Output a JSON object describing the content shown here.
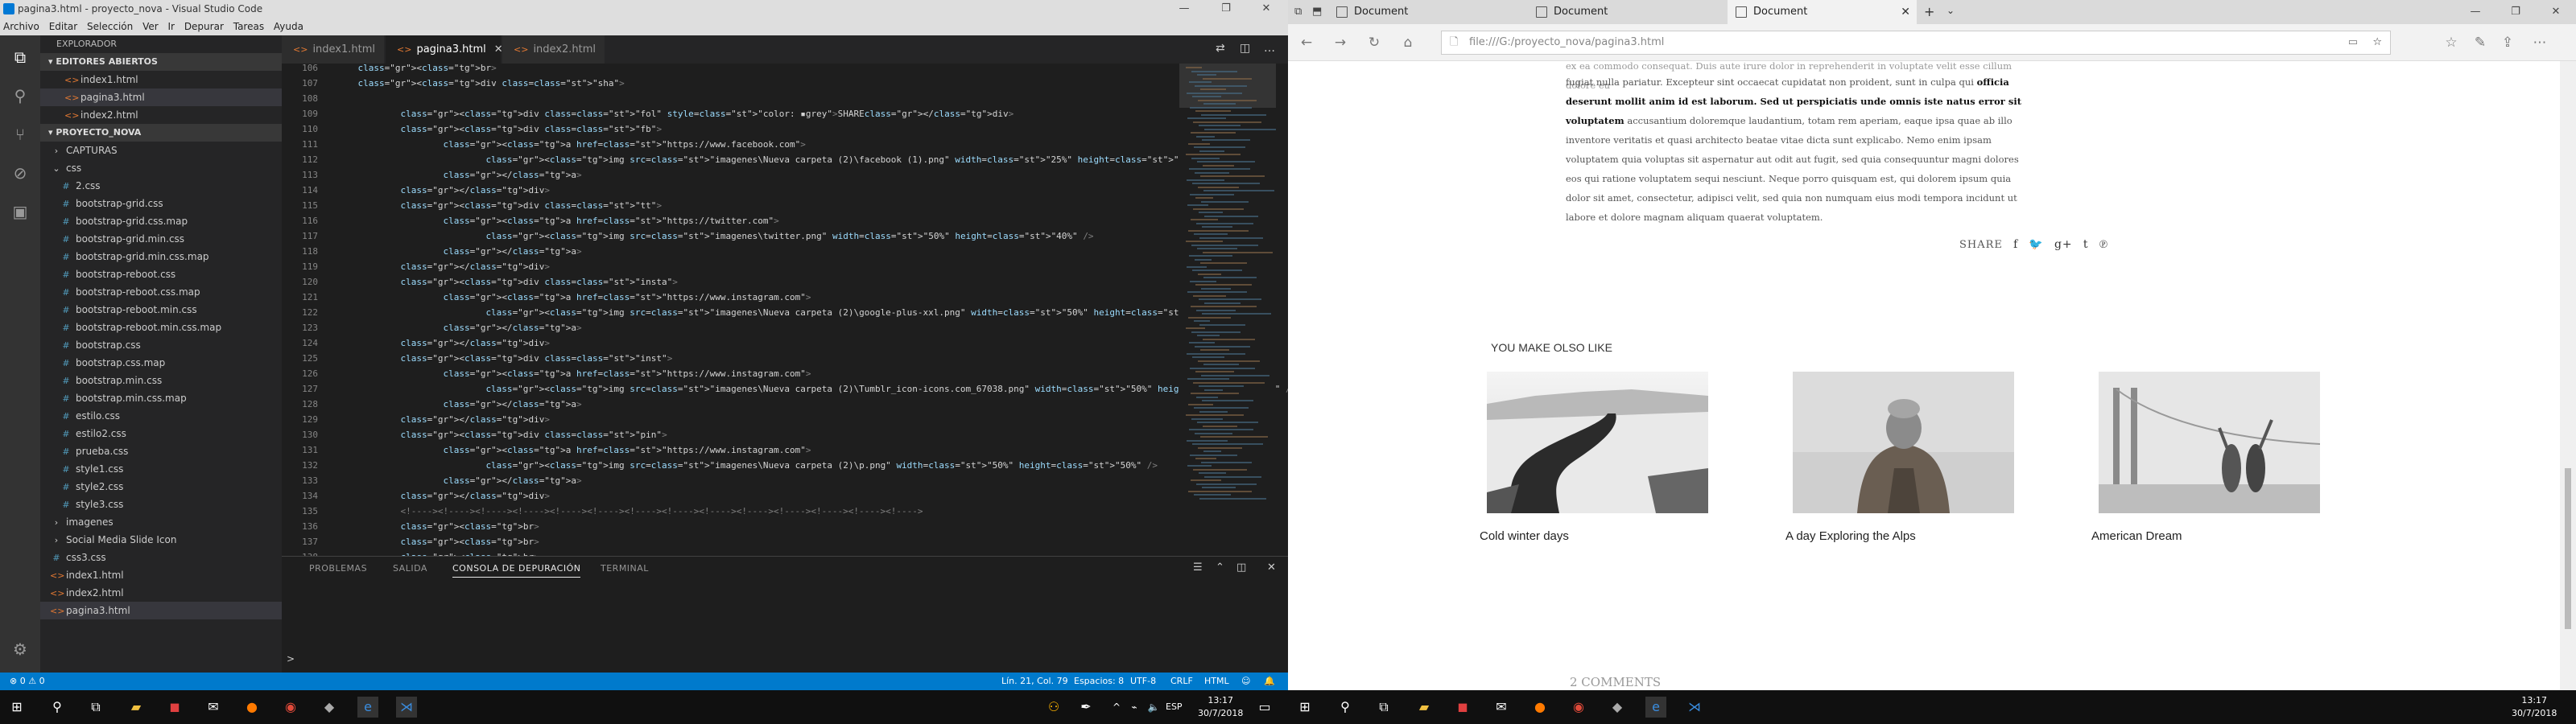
{
  "vscode": {
    "title": "pagina3.html - proyecto_nova - Visual Studio Code",
    "menu": [
      "Archivo",
      "Editar",
      "Selección",
      "Ver",
      "Ir",
      "Depurar",
      "Tareas",
      "Ayuda"
    ],
    "explorer_title": "EXPLORADOR",
    "open_editors_title": "EDITORES ABIERTOS",
    "open_editors": [
      "index1.html",
      "pagina3.html",
      "index2.html"
    ],
    "project_title": "PROYECTO_NOVA",
    "tree": [
      {
        "label": "CAPTURAS",
        "type": "folder",
        "depth": 1
      },
      {
        "label": "css",
        "type": "folder-open",
        "depth": 1
      },
      {
        "label": "2.css",
        "type": "css",
        "depth": 2
      },
      {
        "label": "bootstrap-grid.css",
        "type": "css",
        "depth": 2
      },
      {
        "label": "bootstrap-grid.css.map",
        "type": "css",
        "depth": 2
      },
      {
        "label": "bootstrap-grid.min.css",
        "type": "css",
        "depth": 2
      },
      {
        "label": "bootstrap-grid.min.css.map",
        "type": "css",
        "depth": 2
      },
      {
        "label": "bootstrap-reboot.css",
        "type": "css",
        "depth": 2
      },
      {
        "label": "bootstrap-reboot.css.map",
        "type": "css",
        "depth": 2
      },
      {
        "label": "bootstrap-reboot.min.css",
        "type": "css",
        "depth": 2
      },
      {
        "label": "bootstrap-reboot.min.css.map",
        "type": "css",
        "depth": 2
      },
      {
        "label": "bootstrap.css",
        "type": "css",
        "depth": 2
      },
      {
        "label": "bootstrap.css.map",
        "type": "css",
        "depth": 2
      },
      {
        "label": "bootstrap.min.css",
        "type": "css",
        "depth": 2
      },
      {
        "label": "bootstrap.min.css.map",
        "type": "css",
        "depth": 2
      },
      {
        "label": "estilo.css",
        "type": "css",
        "depth": 2
      },
      {
        "label": "estilo2.css",
        "type": "css",
        "depth": 2
      },
      {
        "label": "prueba.css",
        "type": "css",
        "depth": 2
      },
      {
        "label": "style1.css",
        "type": "css",
        "depth": 2
      },
      {
        "label": "style2.css",
        "type": "css",
        "depth": 2
      },
      {
        "label": "style3.css",
        "type": "css",
        "depth": 2
      },
      {
        "label": "imagenes",
        "type": "folder",
        "depth": 1
      },
      {
        "label": "Social Media Slide Icon",
        "type": "folder",
        "depth": 1
      },
      {
        "label": "css3.css",
        "type": "css",
        "depth": 1
      },
      {
        "label": "index1.html",
        "type": "html",
        "depth": 1
      },
      {
        "label": "index2.html",
        "type": "html",
        "depth": 1
      },
      {
        "label": "pagina3.html",
        "type": "html",
        "depth": 1
      }
    ],
    "tabs": [
      "index1.html",
      "pagina3.html",
      "index2.html"
    ],
    "active_tab": "pagina3.html",
    "line_start": 106,
    "code_lines": [
      "    <br>",
      "    <div class=\"sha\">",
      "",
      "            <div class=\"fol\" style=\"color: ▪grey\">SHARE</div>",
      "            <div class=\"fb\">",
      "                    <a href=\"https://www.facebook.com\">",
      "                            <img src=\"imagenes\\Nueva carpeta (2)\\facebook (1).png\" width=\"25%\" height=\"40%\" />",
      "                    </a>",
      "            </div>",
      "            <div class=\"tt\">",
      "                    <a href=\"https://twitter.com\">",
      "                            <img src=\"imagenes\\twitter.png\" width=\"50%\" height=\"40%\" />",
      "                    </a>",
      "            </div>",
      "            <div class=\"insta\">",
      "                    <a href=\"https://www.instagram.com\">",
      "                            <img src=\"imagenes\\Nueva carpeta (2)\\google-plus-xxl.png\" width=\"50%\" height=\"50%\" />",
      "                    </a>",
      "            </div>",
      "            <div class=\"inst\">",
      "                    <a href=\"https://www.instagram.com\">",
      "                            <img src=\"imagenes\\Nueva carpeta (2)\\Tumblr_icon-icons.com_67038.png\" width=\"50%\" height=\"50%\" />",
      "                    </a>",
      "            </div>",
      "            <div class=\"pin\">",
      "                    <a href=\"https://www.instagram.com\">",
      "                            <img src=\"imagenes\\Nueva carpeta (2)\\p.png\" width=\"50%\" height=\"50%\" />",
      "                    </a>",
      "            </div>",
      "            <!----><!----><!----><!----><!----><!----><!----><!----><!----><!----><!----><!----><!----><!---->",
      "            <br>",
      "            <br>",
      "            <br>"
    ],
    "panel_tabs": [
      "PROBLEMAS",
      "SALIDA",
      "CONSOLA DE DEPURACIÓN",
      "TERMINAL"
    ],
    "active_panel_tab": "CONSOLA DE DEPURACIÓN",
    "panel_prompt": ">",
    "status_left": "⊗ 0  ⚠ 0",
    "status_right": [
      "Lín. 21, Col. 79",
      "Espacios: 8",
      "UTF-8",
      "CRLF",
      "HTML",
      "☺",
      "🔔"
    ]
  },
  "edge": {
    "tabs": [
      "Document",
      "Document",
      "Document"
    ],
    "active_tab_index": 2,
    "url": "file:///G:/proyecto_nova/pagina3.html",
    "para1": "fugiat nulla pariatur. Excepteur sint occaecat cupidatat non proident, sunt in culpa qui",
    "para1_bold_a": "officia deserunt mollit anim id est laborum. Sed ut perspiciatis unde omnis iste natus error sit voluptatem",
    "para1_rest": "accusantium doloremque laudantium, totam rem aperiam, eaque ipsa quae ab illo inventore veritatis et quasi architecto beatae vitae dicta sunt explicabo. Nemo enim ipsam voluptatem quia voluptas sit aspernatur aut odit aut fugit, sed quia consequuntur magni dolores eos qui ratione voluptatem sequi nesciunt. Neque porro quisquam est, qui dolorem ipsum quia dolor sit amet, consectetur, adipisci velit, sed quia non numquam eius modi tempora incidunt ut labore et dolore magnam aliquam quaerat voluptatem.",
    "para0": "ex ea commodo consequat. Duis aute irure dolor in reprehenderit in voluptate velit esse cillum dolore eu",
    "share_label": "SHARE",
    "share_icons": [
      "f",
      "🐦",
      "g+",
      "t",
      "℗"
    ],
    "ymal_title": "YOU MAKE OLSO LIKE",
    "cards": [
      {
        "title": "Cold winter days"
      },
      {
        "title": "A day Exploring the Alps"
      },
      {
        "title": "American Dream"
      }
    ],
    "comments": "2 COMMENTS"
  },
  "taskbar": {
    "time": "13:17",
    "date": "30/7/2018",
    "lang": "ESP"
  }
}
